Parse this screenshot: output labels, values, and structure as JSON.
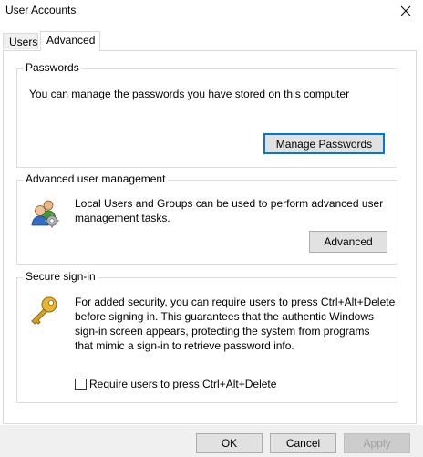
{
  "window": {
    "title": "User Accounts"
  },
  "tabs": [
    {
      "label": "Users",
      "active": false
    },
    {
      "label": "Advanced",
      "active": true
    }
  ],
  "passwords": {
    "title": "Passwords",
    "description": "You can manage the passwords you have stored on this computer",
    "button_label": "Manage Passwords"
  },
  "advanced_user_management": {
    "title": "Advanced user management",
    "description_line1": "Local Users and Groups can be used to perform advanced user",
    "description_line2": "management tasks.",
    "button_label": "Advanced",
    "icon": "users-group-icon"
  },
  "secure_signin": {
    "title": "Secure sign-in",
    "description_lines": [
      "For added security, you can require users to press Ctrl+Alt+Delete",
      "before signing in. This guarantees that the authentic Windows",
      "sign-in screen appears, protecting the system from programs",
      "that mimic a sign-in to retrieve password info."
    ],
    "checkbox_label": "Require users to press Ctrl+Alt+Delete",
    "checkbox_checked": false,
    "icon": "key-icon"
  },
  "footer": {
    "ok_label": "OK",
    "cancel_label": "Cancel",
    "apply_label": "Apply"
  },
  "colors": {
    "accent": "#0078d7",
    "button_face": "#e1e1e1",
    "footer_bg": "#f0f0f0"
  }
}
